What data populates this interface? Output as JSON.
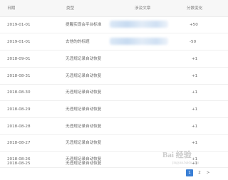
{
  "columns": [
    "日期",
    "类型",
    "涉及文章",
    "分数变化"
  ],
  "rows": [
    {
      "date": "2019-01-01",
      "type": "提醒实现会平台标准",
      "change": "+50"
    },
    {
      "date": "2019-01-01",
      "type": "去他的的标题",
      "change": "-50"
    },
    {
      "date": "2018-09-01",
      "type": "无违规记录自动恢复",
      "change": "+1"
    },
    {
      "date": "2018-08-31",
      "type": "无违规记录自动恢复",
      "change": "+1"
    },
    {
      "date": "2018-08-30",
      "type": "无违规记录自动恢复",
      "change": "+1"
    },
    {
      "date": "2018-08-29",
      "type": "无违规记录自动恢复",
      "change": "+1"
    },
    {
      "date": "2018-08-28",
      "type": "无违规记录自动恢复",
      "change": "+1"
    },
    {
      "date": "2018-08-27",
      "type": "无违规记录自动恢复",
      "change": "+1"
    },
    {
      "date": "2018-08-26",
      "type": "无违规记录自动恢复",
      "change": "+1"
    },
    {
      "date": "2018-08-25",
      "type": "无违规记录自动恢复",
      "change": "+1"
    }
  ],
  "pagination": {
    "prev": "<",
    "pages": [
      "1",
      "2"
    ],
    "next": ">",
    "current": "1"
  },
  "watermark": {
    "text": "Bai 经验",
    "sub": "jingyan.baidu.com"
  },
  "colors": {
    "accent": "#3a7fd5",
    "header_bg": "#f7f7f7"
  }
}
